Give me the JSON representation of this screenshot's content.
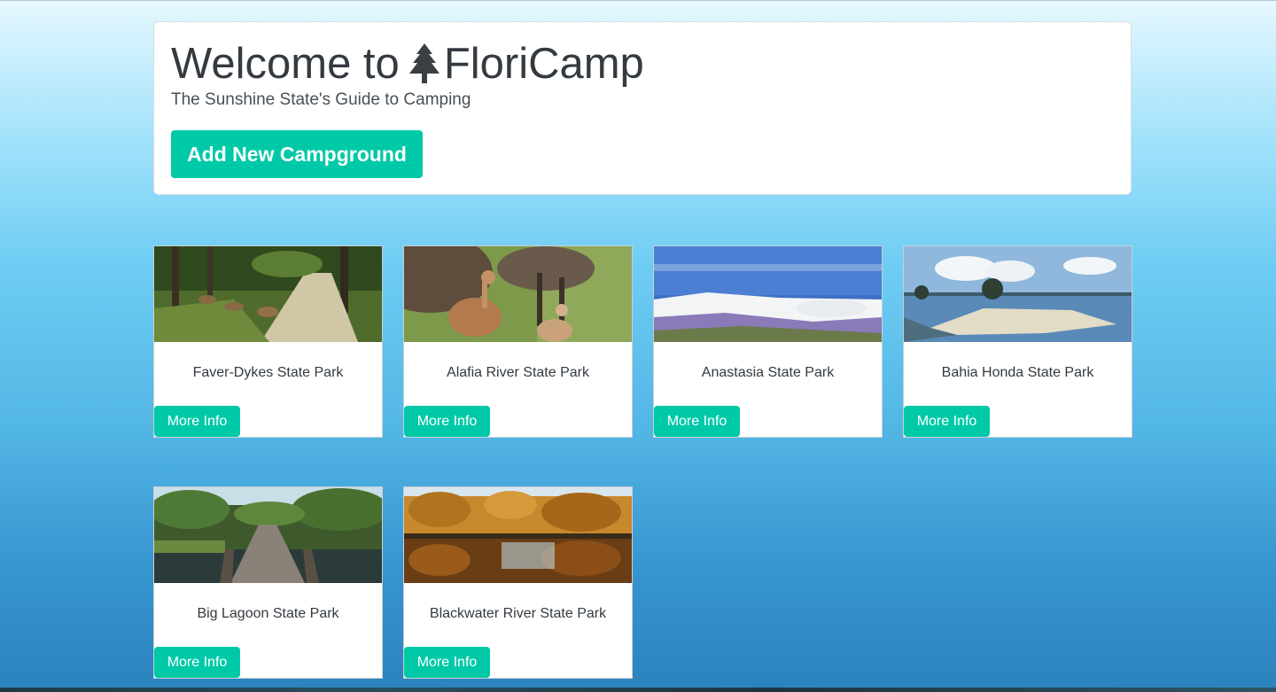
{
  "header": {
    "title_prefix": "Welcome to",
    "brand_icon": "tree-icon",
    "brand_name": "FloriCamp",
    "subtitle": "The Sunshine State's Guide to Camping",
    "add_button_label": "Add New Campground"
  },
  "campgrounds": [
    {
      "name": "Faver-Dykes State Park",
      "image": "deer-in-forest-clearing",
      "button_label": "More Info"
    },
    {
      "name": "Alafia River State Park",
      "image": "sandhill-cranes",
      "button_label": "More Info"
    },
    {
      "name": "Anastasia State Park",
      "image": "white-sand-dunes",
      "button_label": "More Info"
    },
    {
      "name": "Bahia Honda State Park",
      "image": "beach-sandbar",
      "button_label": "More Info"
    },
    {
      "name": "Big Lagoon State Park",
      "image": "boardwalk-over-water",
      "button_label": "More Info"
    },
    {
      "name": "Blackwater River State Park",
      "image": "autumn-trees-reflection",
      "button_label": "More Info"
    }
  ],
  "colors": {
    "accent": "#00c9a7",
    "text": "#343a40"
  }
}
